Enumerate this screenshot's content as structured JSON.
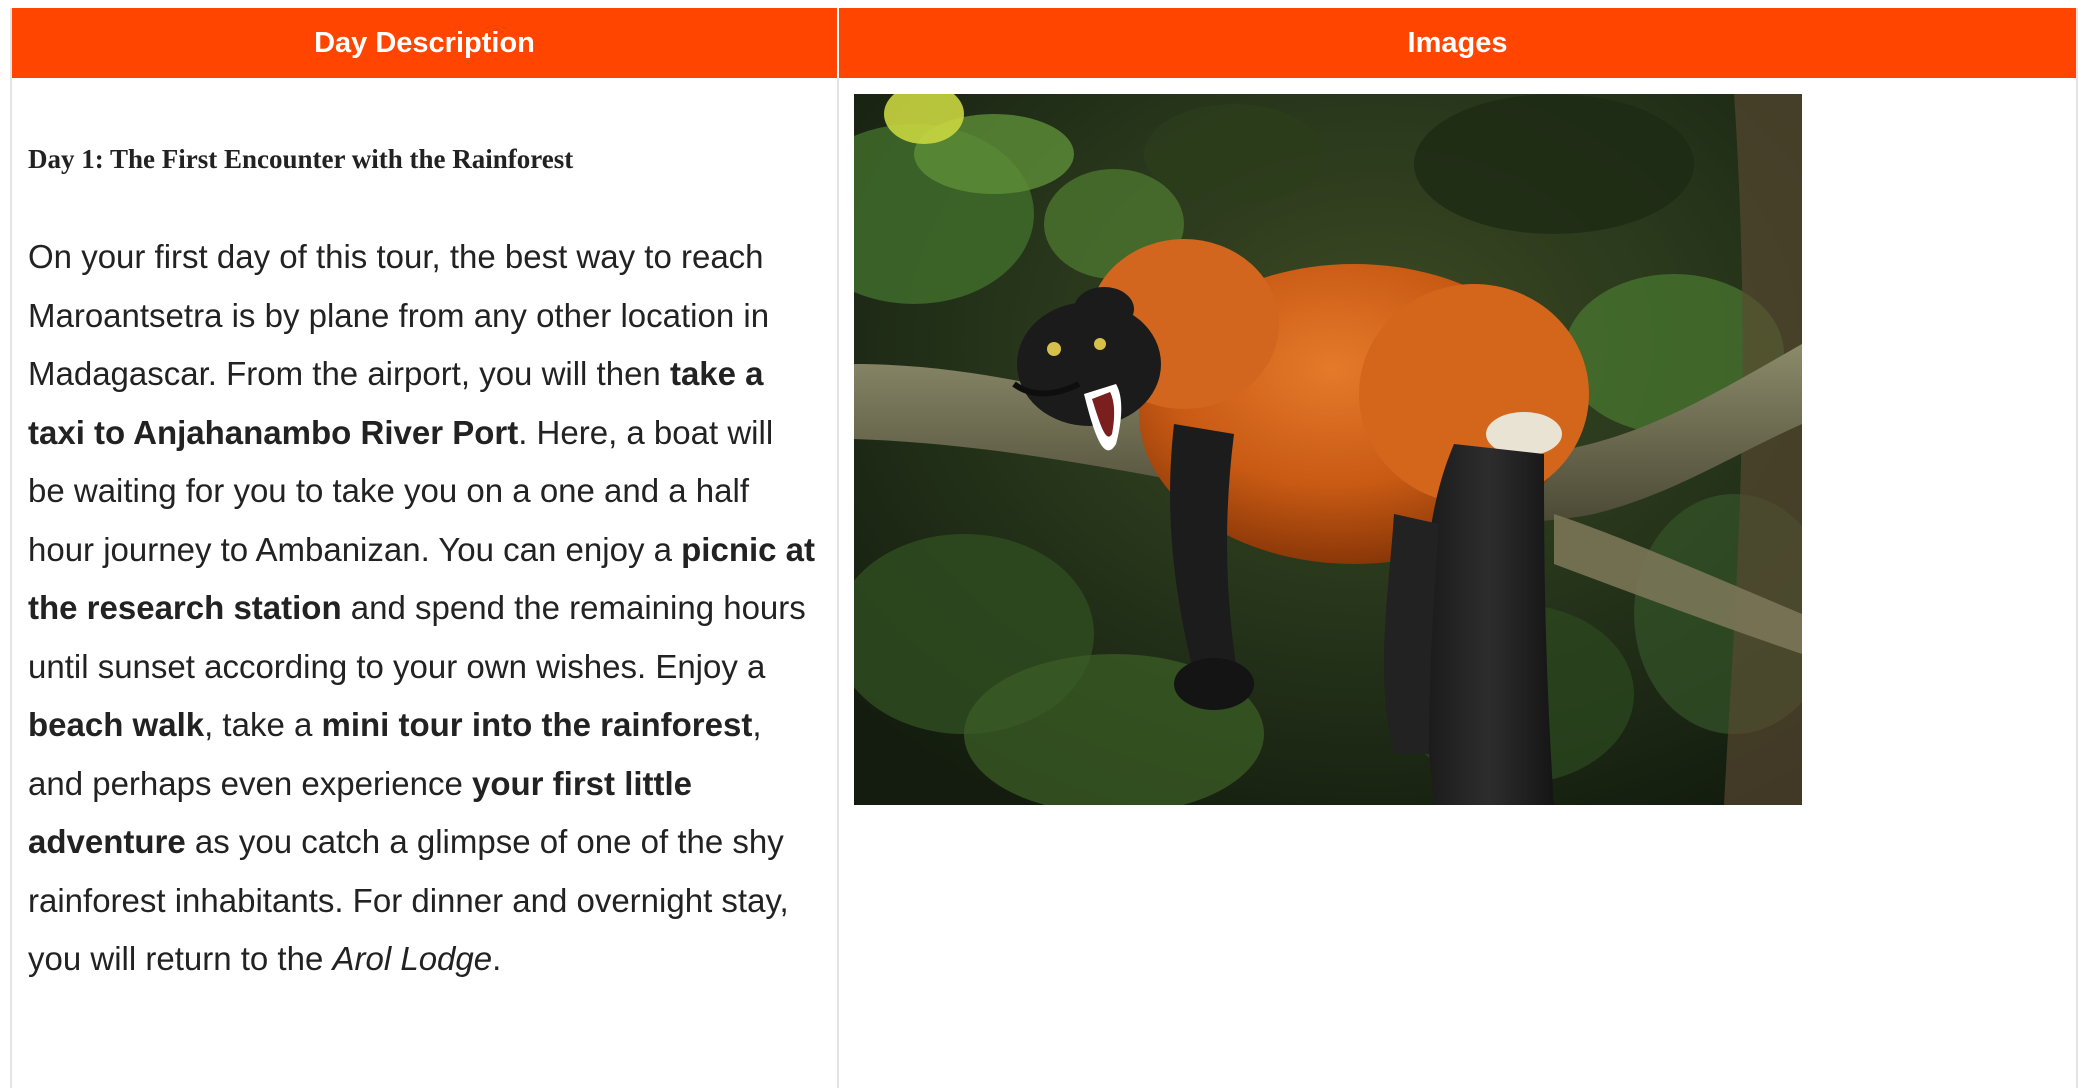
{
  "table": {
    "headers": [
      "Day Description",
      "Images"
    ]
  },
  "day": {
    "title": "Day 1: The First Encounter with the Rainforest",
    "segments": [
      {
        "text": "On your first day of this tour, the best way to reach Maroantsetra is by plane from any other location in Madagascar. From the airport, you will then ",
        "style": "normal"
      },
      {
        "text": "take a taxi to Anjahanambo River Port",
        "style": "bold"
      },
      {
        "text": ". Here, a boat will be waiting for you to take you on a one and a half hour journey to Ambanizan. You can enjoy a ",
        "style": "normal"
      },
      {
        "text": "picnic at the research station",
        "style": "bold"
      },
      {
        "text": " and spend the remaining hours until sunset according to your own wishes. Enjoy a ",
        "style": "normal"
      },
      {
        "text": "beach walk",
        "style": "bold"
      },
      {
        "text": ", take a ",
        "style": "normal"
      },
      {
        "text": "mini tour into the rainforest",
        "style": "bold"
      },
      {
        "text": ", and perhaps even experience ",
        "style": "normal"
      },
      {
        "text": "your first little adventure",
        "style": "bold"
      },
      {
        "text": " as you catch a glimpse of one of the shy rainforest inhabitants. For dinner and overnight stay, you will return to the ",
        "style": "normal"
      },
      {
        "text": "Arol Lodge",
        "style": "italic"
      },
      {
        "text": ".",
        "style": "normal"
      }
    ]
  },
  "image": {
    "subject": "red-ruffed-lemur-photo"
  },
  "colors": {
    "header_bg": "#ff4500",
    "header_text": "#ffffff",
    "border": "#e3e3e3",
    "body_text": "#222222"
  }
}
